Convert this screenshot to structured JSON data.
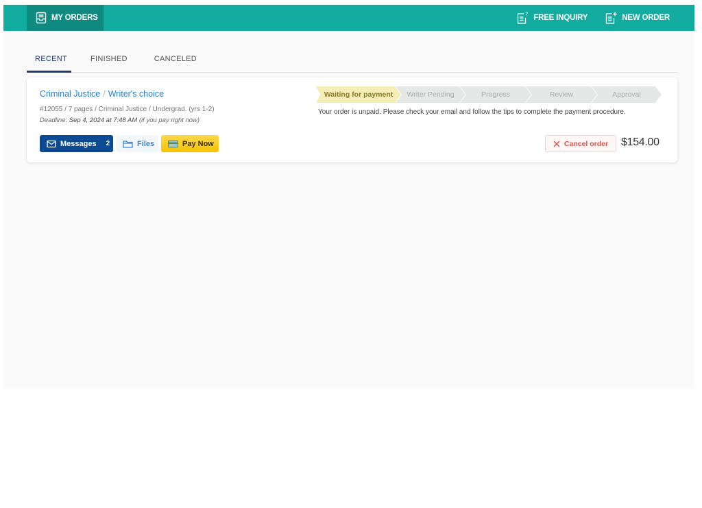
{
  "header": {
    "my_orders": {
      "label": "MY ORDERS",
      "icon": "inbox-tray-icon"
    },
    "free_inquiry": {
      "label": "FREE INQUIRY",
      "icon": "document-question-icon"
    },
    "new_order": {
      "label": "NEW ORDER",
      "icon": "document-plus-icon"
    },
    "colors": {
      "bar": "#12ab9f",
      "active": "#0e8a80"
    }
  },
  "tabs": [
    {
      "label": "RECENT",
      "active": true
    },
    {
      "label": "FINISHED",
      "active": false
    },
    {
      "label": "CANCELED",
      "active": false
    }
  ],
  "order": {
    "subject": "Criminal Justice",
    "title_separator": "/",
    "topic": "Writer's choice",
    "meta": "#12055 / 7 pages / Criminal Justice / Undergrad. (yrs 1-2)",
    "deadline_label": "Deadline:",
    "deadline_value": "Sep 4, 2024 at 7:48 AM",
    "deadline_note": "(if you pay right now)",
    "buttons": {
      "messages": {
        "label": "Messages",
        "count": "2",
        "icon": "envelope-icon"
      },
      "files": {
        "label": "Files",
        "icon": "folder-icon"
      },
      "pay_now": {
        "label": "Pay Now",
        "icon": "credit-card-icon"
      }
    },
    "steps": [
      {
        "label": "Waiting for payment",
        "active": true
      },
      {
        "label": "Writer Pending",
        "active": false
      },
      {
        "label": "Progress",
        "active": false
      },
      {
        "label": "Review",
        "active": false
      },
      {
        "label": "Approval",
        "active": false
      }
    ],
    "status_message": "Your order is unpaid. Please check your email and follow the tips to complete the payment procedure.",
    "cancel": {
      "label": "Cancel order",
      "icon": "close-icon"
    },
    "price": "$154.00"
  }
}
